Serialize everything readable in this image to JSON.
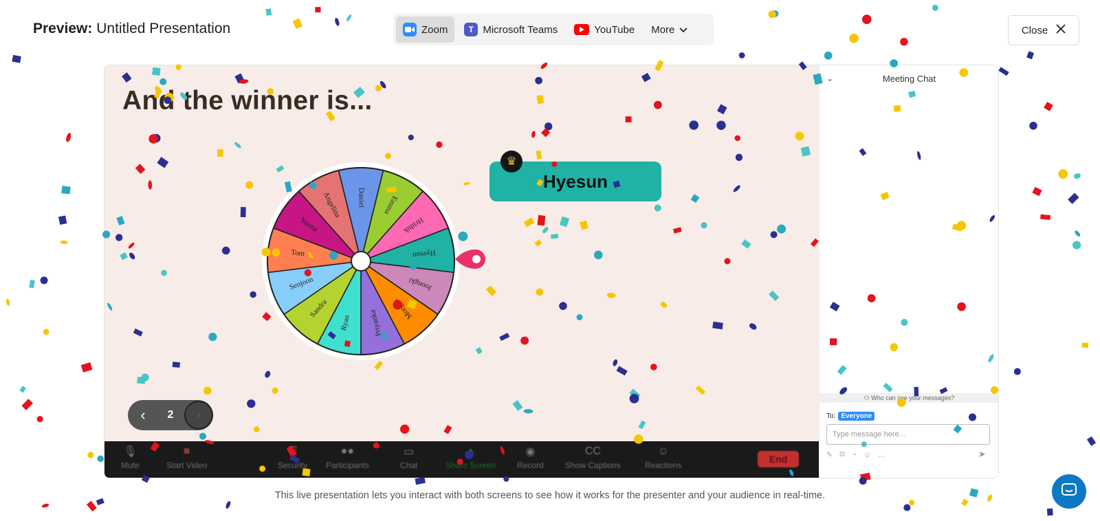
{
  "header": {
    "title_prefix": "Preview:",
    "title": "Untitled Presentation",
    "close_label": "Close"
  },
  "providers": [
    {
      "label": "Zoom",
      "icon": "zoom-icon",
      "active": true
    },
    {
      "label": "Microsoft Teams",
      "icon": "teams-icon"
    },
    {
      "label": "YouTube",
      "icon": "youtube-icon"
    },
    {
      "label": "More",
      "icon": "chevron-down-icon"
    }
  ],
  "slide": {
    "heading": "And the winner is...",
    "winner": "Hyesun",
    "page_number": "2",
    "wheel_names": [
      "Daniel",
      "Emma",
      "Hrithik",
      "Hyesun",
      "Joongki",
      "Morgan",
      "Priyanka",
      "Ryan",
      "Sandra",
      "Seojoon",
      "Tom",
      "Yoona",
      "Angelina"
    ],
    "wheel_colors": [
      "#6b95e9",
      "#9acd32",
      "#ff69b4",
      "#20b2a5",
      "#cc88b8",
      "#ff8c00",
      "#9370db",
      "#40e0d0",
      "#b5d330",
      "#87cefa",
      "#ff7f50",
      "#c71585",
      "#e57373"
    ]
  },
  "toolbar": {
    "mute": "Mute",
    "start_video": "Start Video",
    "security": "Security",
    "participants": "Participants",
    "chat": "Chat",
    "share_screen": "Share Screen",
    "record": "Record",
    "show_captions": "Show Captions",
    "reactions": "Reactions",
    "end": "End"
  },
  "chat": {
    "title": "Meeting Chat",
    "who_can_see": "Who can see your messages?",
    "to_label": "To:",
    "to_value": "Everyone",
    "input_placeholder": "Type message here..."
  },
  "caption": "This live presentation lets you interact with both screens to see how it works for the presenter and your audience in real-time.",
  "colors": {
    "slide_bg": "#f7ece8",
    "winner_bg": "#20b2a5",
    "pointer": "#e9306b",
    "help_btn": "#0d78c4",
    "confetti": [
      "#f7c600",
      "#2aa8c0",
      "#e3141c",
      "#2b2f8f",
      "#48c5c6"
    ]
  }
}
